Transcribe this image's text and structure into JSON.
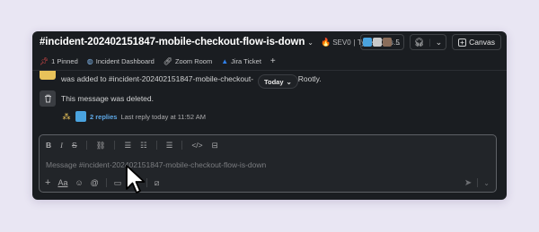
{
  "header": {
    "channel_name": "#incident-202402151847-mobile-checkout-flow-is-down",
    "topic_severity": "SEV0",
    "topic_rest": "| Types: Cus…",
    "member_count": "5",
    "canvas_label": "Canvas"
  },
  "bookmarks": [
    {
      "label": "1 Pinned",
      "icon": "pin-icon"
    },
    {
      "label": "Incident Dashboard",
      "icon": "globe-icon"
    },
    {
      "label": "Zoom Room",
      "icon": "link-icon"
    },
    {
      "label": "Jira Ticket",
      "icon": "jira-icon"
    }
  ],
  "messages": {
    "added_text_a": "was added to #incident-202402151847-mobile-checkout-",
    "added_text_b": "vn by Rootly.",
    "date_pill": "Today",
    "deleted_text": "This message was deleted.",
    "thread_replies": "2 replies",
    "thread_last_reply": "Last reply today at 11:52 AM"
  },
  "composer": {
    "placeholder": "Message #incident-202402151847-mobile-checkout-flow-is-down"
  },
  "colors": {
    "window_bg": "#1a1d21",
    "link_blue": "#5ea8e6",
    "page_bg": "#e9e6f3"
  }
}
